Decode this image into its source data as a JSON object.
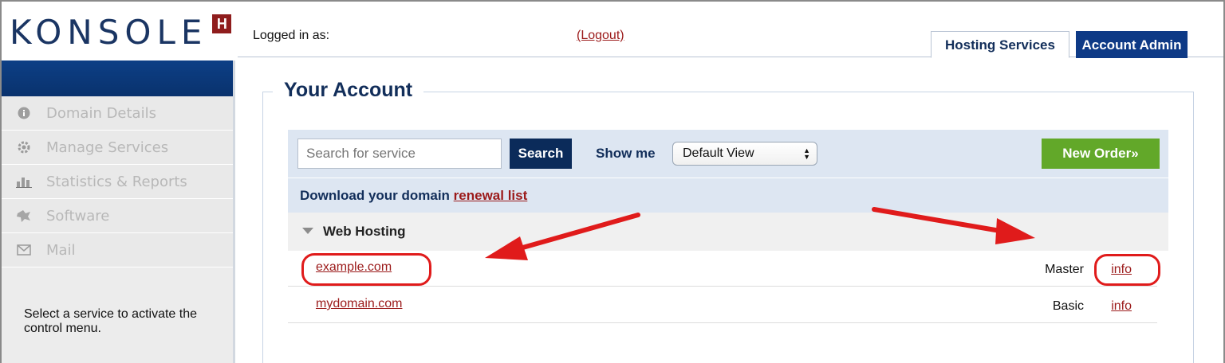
{
  "header": {
    "logo_text": "KONSOLE",
    "logo_badge": "H",
    "logged_in_label": "Logged in as:",
    "logout_label": "(Logout)",
    "tabs": [
      {
        "label": "Hosting Services",
        "active": true
      },
      {
        "label": "Account Admin",
        "active": false
      }
    ]
  },
  "sidebar": {
    "items": [
      {
        "label": "Domain Details",
        "icon": "info-icon"
      },
      {
        "label": "Manage Services",
        "icon": "gear-icon"
      },
      {
        "label": "Statistics & Reports",
        "icon": "bar-chart-icon"
      },
      {
        "label": "Software",
        "icon": "puzzle-icon"
      },
      {
        "label": "Mail",
        "icon": "envelope-icon"
      }
    ],
    "message": "Select a service to activate the control menu."
  },
  "main": {
    "title": "Your Account",
    "search": {
      "placeholder": "Search for service",
      "button_label": "Search"
    },
    "show_me": {
      "label": "Show me",
      "selected": "Default View"
    },
    "new_order_label": "New Order»",
    "renewal": {
      "prefix": "Download your domain ",
      "link": "renewal list"
    },
    "group": {
      "label": "Web Hosting"
    },
    "domains": [
      {
        "name": "example.com",
        "plan": "Master",
        "info": "info"
      },
      {
        "name": "mydomain.com",
        "plan": "Basic",
        "info": "info"
      }
    ]
  },
  "colors": {
    "navy": "#122e5a",
    "accent_red": "#9b1a1a",
    "annotation_red": "#e01b1b",
    "new_order_green": "#62a829",
    "tab_blue": "#0e3a86"
  }
}
